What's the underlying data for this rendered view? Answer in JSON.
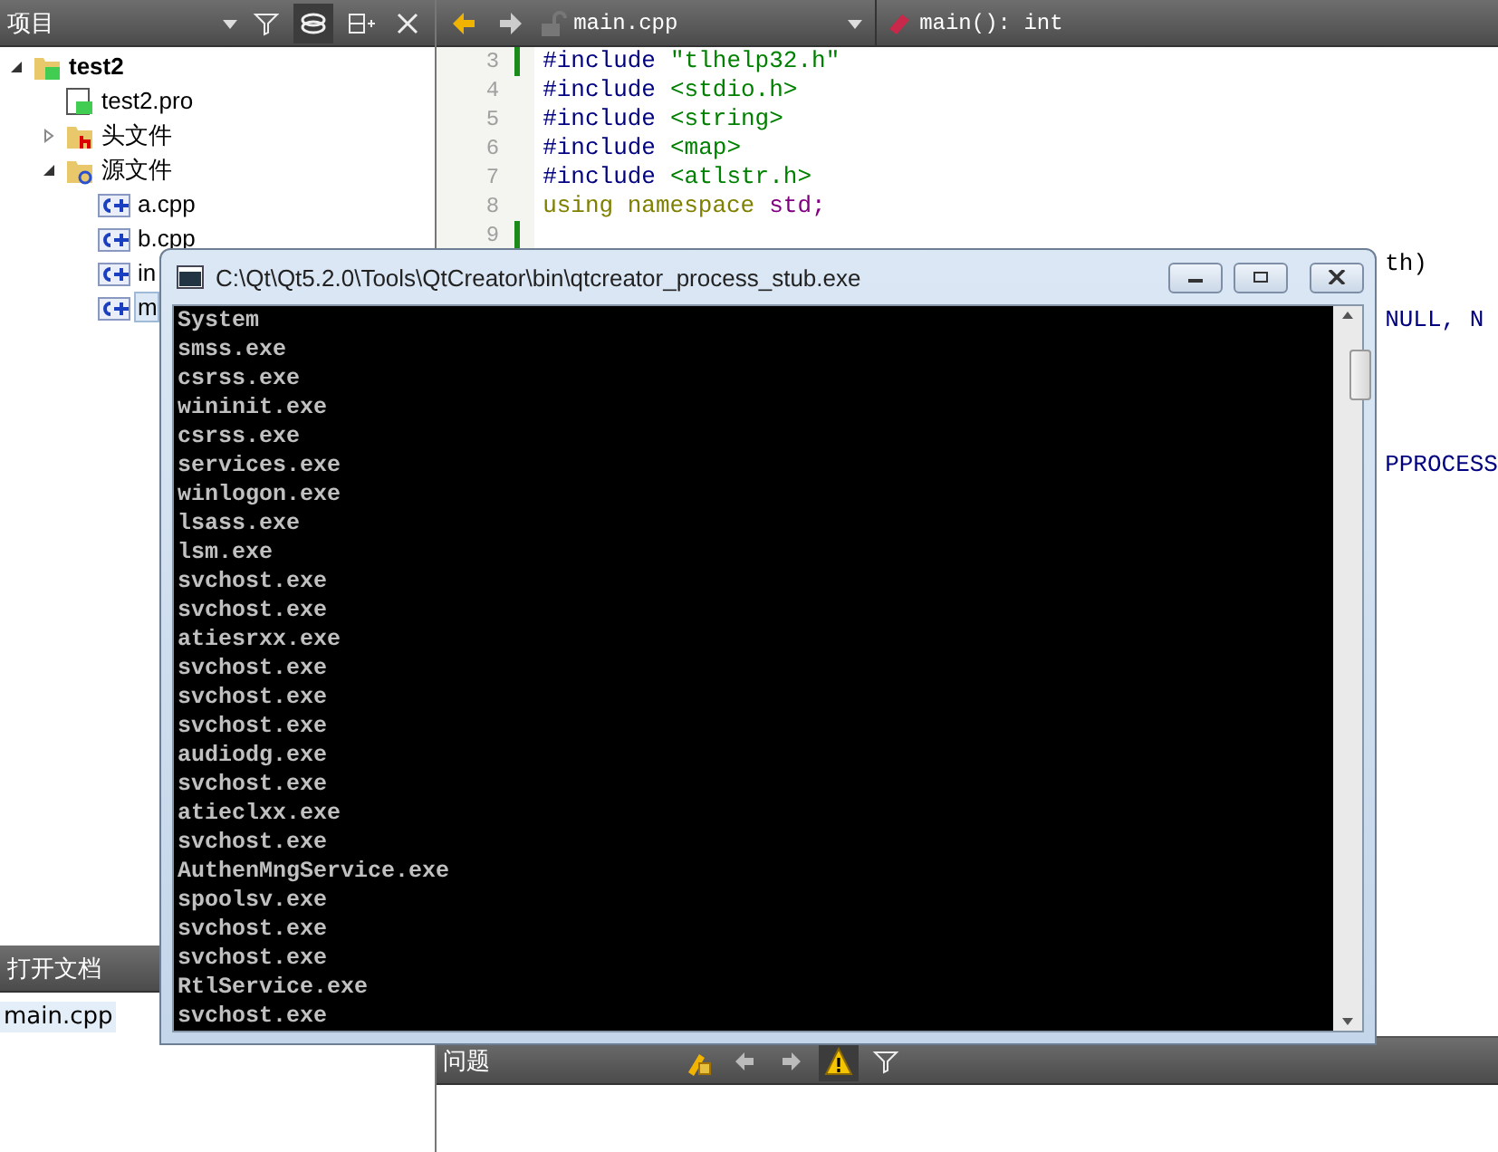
{
  "projects_panel": {
    "title": "项目",
    "tree": [
      {
        "label": "test2",
        "kind": "project",
        "expanded": true,
        "selected": false,
        "children": [
          {
            "label": "test2.pro",
            "kind": "pro",
            "selected": false
          },
          {
            "label": "头文件",
            "kind": "header-folder",
            "expanded": false,
            "selected": false
          },
          {
            "label": "源文件",
            "kind": "source-folder",
            "expanded": true,
            "selected": false,
            "children": [
              {
                "label": "a.cpp",
                "kind": "cpp",
                "selected": false
              },
              {
                "label": "b.cpp",
                "kind": "cpp",
                "selected": false
              },
              {
                "label": "in",
                "kind": "cpp",
                "selected": false
              },
              {
                "label": "m",
                "kind": "cpp",
                "selected": true
              }
            ]
          }
        ]
      }
    ]
  },
  "open_documents": {
    "title": "打开文档",
    "items": [
      {
        "label": "main.cpp",
        "selected": true
      }
    ]
  },
  "editor": {
    "file": "main.cpp",
    "symbol": "main(): int",
    "lines": [
      {
        "number": "3",
        "marker": true,
        "tokens": [
          {
            "kind": "directive",
            "text": "#include"
          },
          {
            "kind": "string",
            "text": "\"tlhelp32.h\""
          }
        ]
      },
      {
        "number": "4",
        "marker": false,
        "tokens": [
          {
            "kind": "directive",
            "text": "#include"
          },
          {
            "kind": "string",
            "text": "<stdio.h>"
          }
        ]
      },
      {
        "number": "5",
        "marker": false,
        "tokens": [
          {
            "kind": "directive",
            "text": "#include"
          },
          {
            "kind": "string",
            "text": "<string>"
          }
        ]
      },
      {
        "number": "6",
        "marker": false,
        "tokens": [
          {
            "kind": "directive",
            "text": "#include"
          },
          {
            "kind": "string",
            "text": "<map>"
          }
        ]
      },
      {
        "number": "7",
        "marker": false,
        "tokens": [
          {
            "kind": "directive",
            "text": "#include"
          },
          {
            "kind": "string",
            "text": "<atlstr.h>"
          }
        ]
      },
      {
        "number": "8",
        "marker": false,
        "tokens": [
          {
            "kind": "keyword",
            "text": "using namespace"
          },
          {
            "kind": "type",
            "text": "std;"
          }
        ]
      },
      {
        "number": "9",
        "marker": true
      }
    ],
    "fragments": [
      {
        "kind": "plain",
        "text": "th)"
      },
      {
        "kind": "directive",
        "text": "NULL, N"
      },
      {
        "kind": "directive",
        "text": "PPROCESS"
      }
    ]
  },
  "issues_panel": {
    "title": "问题",
    "warnings_filter_on": true
  },
  "console_window": {
    "title": "C:\\Qt\\Qt5.2.0\\Tools\\QtCreator\\bin\\qtcreator_process_stub.exe",
    "lines": [
      "System",
      "smss.exe",
      "csrss.exe",
      "wininit.exe",
      "csrss.exe",
      "services.exe",
      "winlogon.exe",
      "lsass.exe",
      "lsm.exe",
      "svchost.exe",
      "svchost.exe",
      "atiesrxx.exe",
      "svchost.exe",
      "svchost.exe",
      "svchost.exe",
      "audiodg.exe",
      "svchost.exe",
      "atieclxx.exe",
      "svchost.exe",
      "AuthenMngService.exe",
      "spoolsv.exe",
      "svchost.exe",
      "svchost.exe",
      "RtlService.exe",
      "svchost.exe"
    ]
  }
}
